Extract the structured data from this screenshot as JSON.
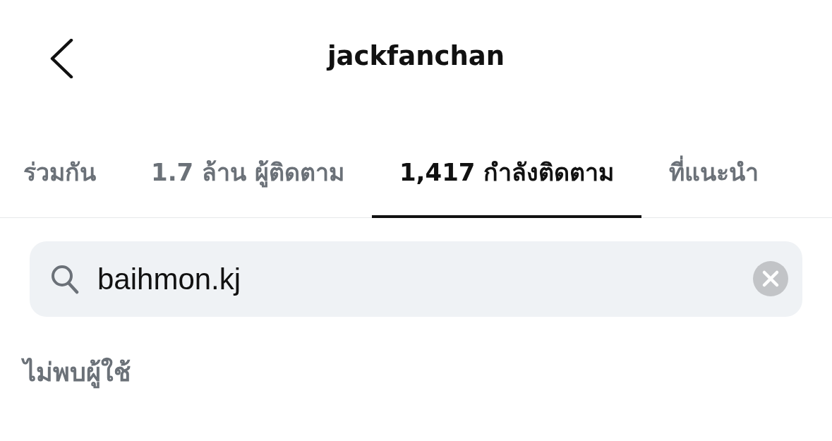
{
  "header": {
    "title": "jackfanchan"
  },
  "tabs": [
    {
      "label": "ร่วมกัน",
      "selected": false
    },
    {
      "label": "1.7 ล้าน ผู้ติดตาม",
      "selected": false
    },
    {
      "label": "1,417 กำลังติดตาม",
      "selected": true
    },
    {
      "label": "ที่แนะนำ",
      "selected": false
    }
  ],
  "search": {
    "value": "baihmon.kj"
  },
  "message": "ไม่พบผู้ใช้"
}
